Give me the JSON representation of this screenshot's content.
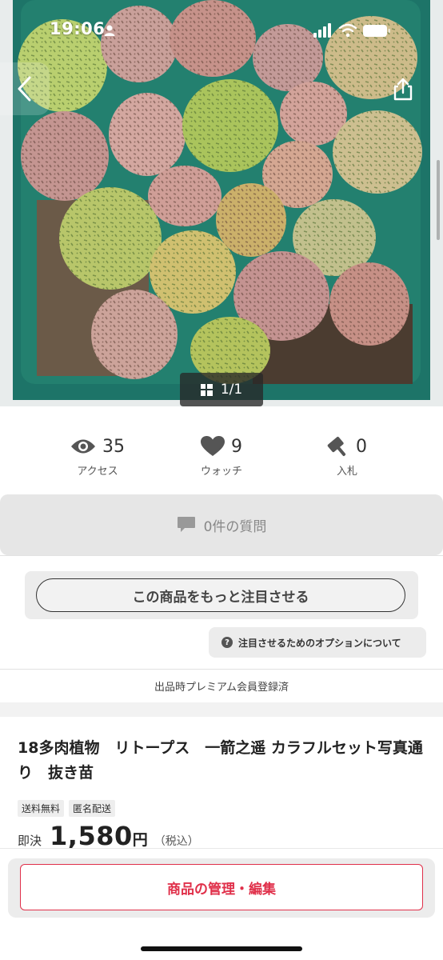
{
  "status_bar": {
    "time": "19:06"
  },
  "photo": {
    "counter": "1/1"
  },
  "stats": [
    {
      "icon": "eye-icon",
      "value": "35",
      "label": "アクセス"
    },
    {
      "icon": "heart-icon",
      "value": "9",
      "label": "ウォッチ"
    },
    {
      "icon": "gavel-icon",
      "value": "0",
      "label": "入札"
    }
  ],
  "questions": {
    "label": "0件の質問"
  },
  "promote": {
    "button_label": "この商品をもっと注目させる",
    "options_label": "注目させるためのオプションについて"
  },
  "premium_note": "出品時プレミアム会員登録済",
  "item": {
    "title": "18多肉植物　リトープス　一箭之遥 カラフルセット写真通り　抜き苗",
    "badges": [
      "送料無料",
      "匿名配送"
    ],
    "price_kind": "即決",
    "price": "1,580",
    "price_unit": "円",
    "tax": "（税込）"
  },
  "bottom": {
    "manage_label": "商品の管理・編集"
  },
  "colors": {
    "accent": "#e0304a",
    "pot": "#1f7a6e"
  }
}
